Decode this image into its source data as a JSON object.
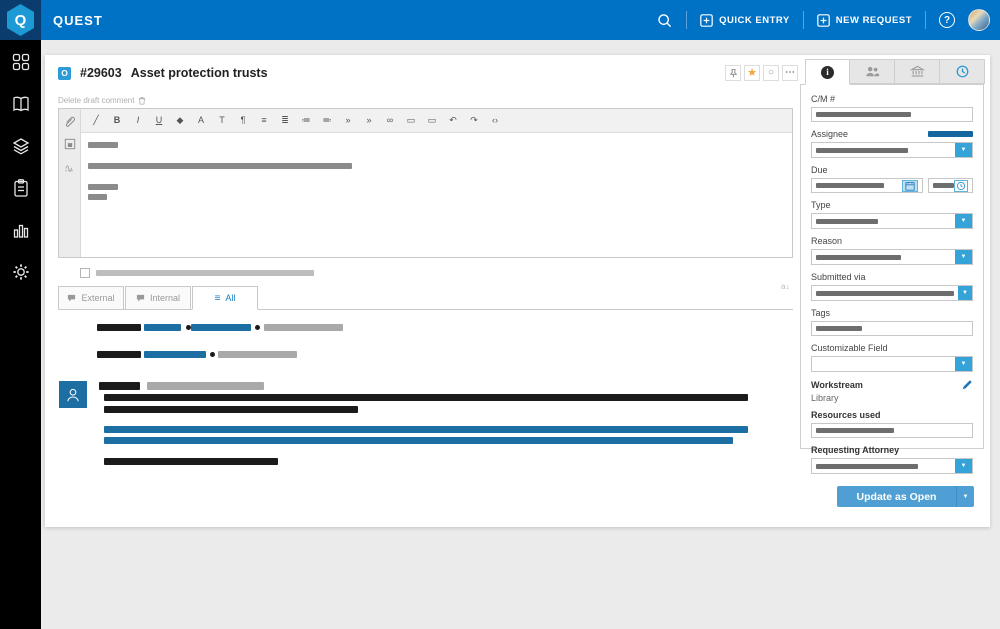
{
  "topbar": {
    "brand": "QUEST",
    "logo_letter": "Q",
    "quick_entry": "QUICK ENTRY",
    "new_request": "NEW REQUEST",
    "help_glyph": "?"
  },
  "sidebar": {
    "items": [
      {
        "name": "dashboard-grid"
      },
      {
        "name": "library-book"
      },
      {
        "name": "collections-layers"
      },
      {
        "name": "requests-clipboard"
      },
      {
        "name": "reports-chart"
      },
      {
        "name": "settings-gear"
      }
    ]
  },
  "request": {
    "status_glyph": "O",
    "id": "#29603",
    "title": "Asset protection trusts"
  },
  "editor": {
    "delete_draft": "Delete draft comment",
    "toolbar_glyphs": [
      "╱",
      "B",
      "I",
      "U",
      "◆",
      "A",
      "T",
      "¶",
      "≡",
      "≣",
      "≔",
      "≕",
      "»",
      "»",
      "∞",
      "▭",
      "▭",
      "↶",
      "↷",
      "‹›"
    ]
  },
  "comments": {
    "tabs": [
      {
        "label": "External"
      },
      {
        "label": "Internal"
      },
      {
        "label": "All"
      }
    ],
    "active_tab": "All",
    "sort_glyph": "a↓"
  },
  "panel": {
    "cm": {
      "label": "C/M #"
    },
    "assignee": {
      "label": "Assignee"
    },
    "due": {
      "label": "Due"
    },
    "type": {
      "label": "Type"
    },
    "reason": {
      "label": "Reason"
    },
    "submitted_via": {
      "label": "Submitted via"
    },
    "tags": {
      "label": "Tags"
    },
    "customizable": {
      "label": "Customizable Field"
    },
    "workstream": {
      "label": "Workstream",
      "value": "Library"
    },
    "resources": {
      "label": "Resources used"
    },
    "requesting": {
      "label": "Requesting Attorney"
    }
  },
  "actions": {
    "update": "Update as Open",
    "caret_glyph": "▼"
  },
  "colors": {
    "topbar_blue": "#0072c6",
    "accent_blue": "#34a3d7",
    "steel_blue": "#1d6fa3",
    "star_orange": "#f2a33c"
  }
}
